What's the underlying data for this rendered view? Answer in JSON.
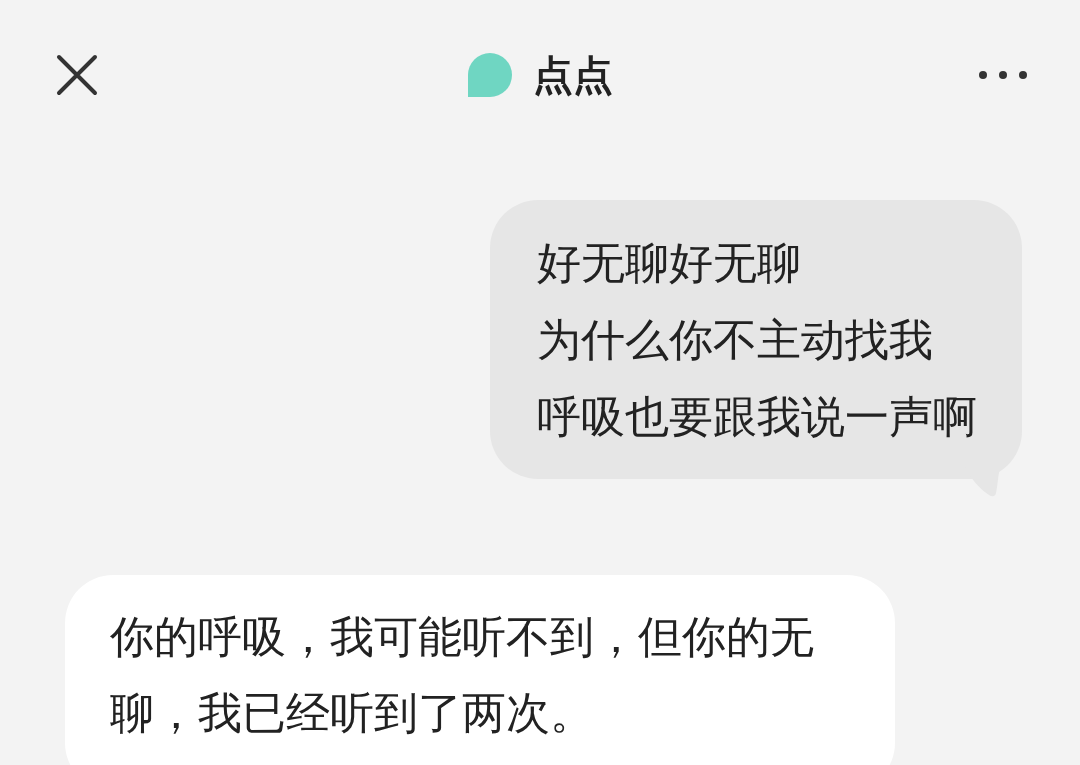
{
  "header": {
    "title": "点点"
  },
  "messages": [
    {
      "kind": "sent",
      "lines": [
        "好无聊好无聊",
        "为什么你不主动找我",
        "呼吸也要跟我说一声啊"
      ]
    },
    {
      "kind": "received",
      "lines": [
        "你的呼吸，我可能听不到，但你的无聊，我已经听到了两次。"
      ]
    }
  ]
}
